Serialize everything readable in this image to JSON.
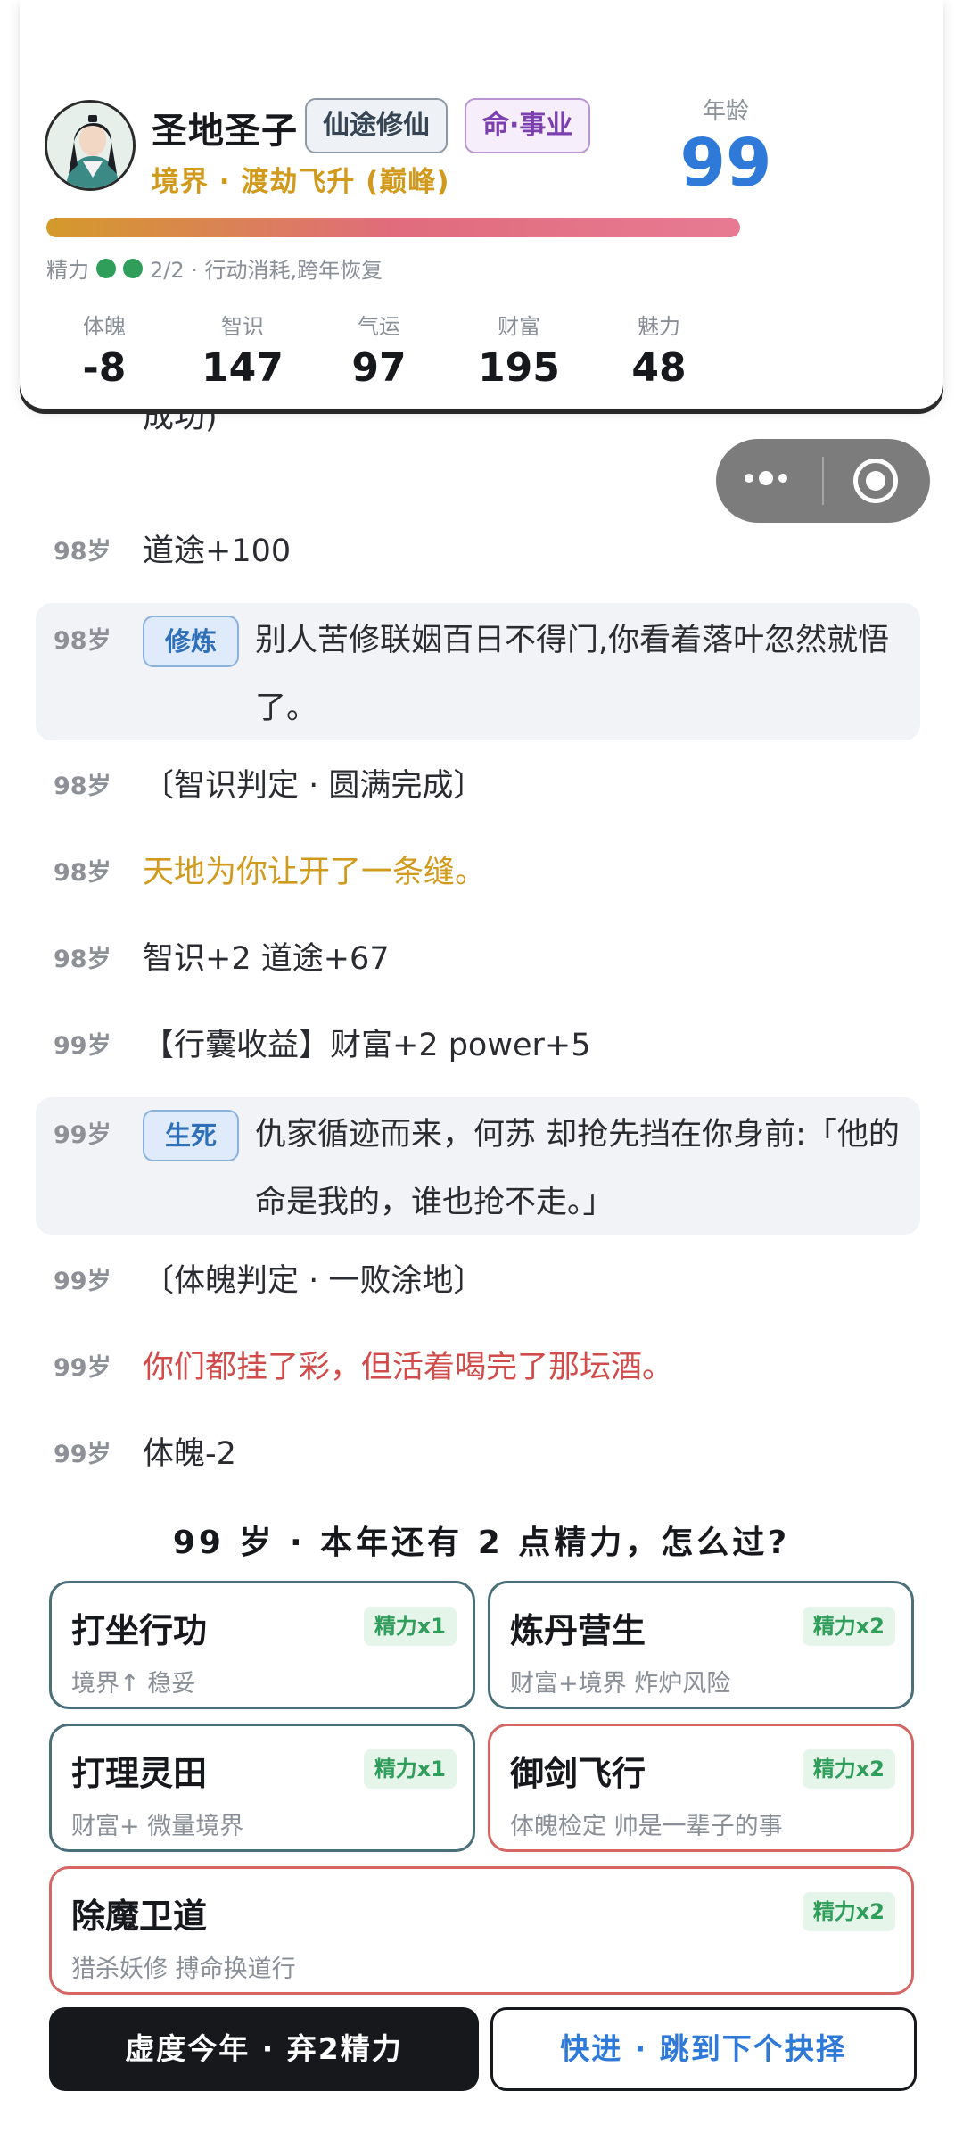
{
  "profile": {
    "name": "圣地圣子",
    "tags": [
      "仙途修仙",
      "命·事业"
    ],
    "realm": "境界 · 渡劫飞升 (巅峰)",
    "age_label": "年龄",
    "age": "99",
    "energy_text": "精力",
    "energy_count": "2/2 · 行动消耗,跨年恢复",
    "stats": [
      {
        "label": "体魄",
        "value": "-8"
      },
      {
        "label": "智识",
        "value": "147"
      },
      {
        "label": "气运",
        "value": "97"
      },
      {
        "label": "财富",
        "value": "195"
      },
      {
        "label": "魅力",
        "value": "48"
      }
    ],
    "colors": {
      "accent": "#2f7ad9",
      "gold": "#d29a1c",
      "energy": "#2f9e5b"
    }
  },
  "log": [
    {
      "age": "",
      "text": "成功)"
    },
    {
      "age": "98岁",
      "text": "道途+100"
    },
    {
      "age": "98岁",
      "chip": "修炼",
      "text": "别人苦修联姻百日不得门,你看着落叶忽然就悟了。"
    },
    {
      "age": "98岁",
      "text": "〔智识判定 · 圆满完成〕"
    },
    {
      "age": "98岁",
      "text": "天地为你让开了一条缝。"
    },
    {
      "age": "98岁",
      "text": "智识+2 道途+67"
    },
    {
      "age": "99岁",
      "text": "【行囊收益】财富+2 power+5"
    },
    {
      "age": "99岁",
      "chip": "生死",
      "text": "仇家循迹而来，何苏 却抢先挡在你身前:「他的命是我的，谁也抢不走。」"
    },
    {
      "age": "99岁",
      "text": "〔体魄判定 · 一败涂地〕"
    },
    {
      "age": "99岁",
      "text": "你们都挂了彩，但活着喝完了那坛酒。"
    },
    {
      "age": "99岁",
      "text": "体魄-2"
    }
  ],
  "prompt": "99 岁 · 本年还有 2 点精力，怎么过?",
  "choices": [
    {
      "title": "打坐行功",
      "sub": "境界↑ 稳妥",
      "cost": "精力x1"
    },
    {
      "title": "炼丹营生",
      "sub": "财富+境界 炸炉风险",
      "cost": "精力x2"
    },
    {
      "title": "打理灵田",
      "sub": "财富+ 微量境界",
      "cost": "精力x1"
    },
    {
      "title": "御剑飞行",
      "sub": "体魄检定 帅是一辈子的事",
      "cost": "精力x2"
    },
    {
      "title": "除魔卫道",
      "sub": "猎杀妖修 搏命换道行",
      "cost": "精力x2"
    }
  ],
  "actions": {
    "skip": "虚度今年 · 弃2精力",
    "fast_forward": "快进 · 跳到下个抉择"
  }
}
